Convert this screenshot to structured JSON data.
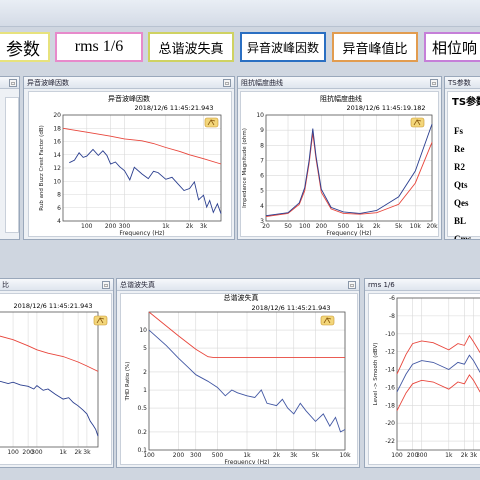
{
  "tabs": [
    {
      "label": "参数",
      "color": "#e7e27d"
    },
    {
      "label": "rms 1/6",
      "color": "#e78acb"
    },
    {
      "label": "总谐波失真",
      "color": "#cfd262"
    },
    {
      "label": "异音波峰因数",
      "color": "#2a6fc2"
    },
    {
      "label": "异音峰值比",
      "color": "#e29c4f"
    },
    {
      "label": "相位响",
      "color": "#c57fd8"
    }
  ],
  "panels": {
    "crest": {
      "header": "异音波峰因数",
      "title": "异音波峰因数",
      "timestamp": "2018/12/6 11:45:21.943"
    },
    "impedance": {
      "header": "阻抗幅度曲线",
      "title": "阻抗幅度曲线",
      "timestamp": "2018/12/6 11:45:19.182"
    },
    "ts": {
      "header": "TS参数",
      "title": "TS参数",
      "params": [
        "Fs",
        "Re",
        "R2",
        "Qts",
        "Qes",
        "BL",
        "Cms"
      ]
    },
    "ratio": {
      "header": "比",
      "timestamp": "2018/12/6 11:45:21.943"
    },
    "thd": {
      "header": "总谐波失真",
      "title": "总谐波失真",
      "timestamp": "2018/12/6 11:45:21.943"
    },
    "rms": {
      "header": "rms 1/6"
    }
  },
  "chart_data": [
    {
      "type": "line",
      "title": "异音波峰因数",
      "xlabel": "Frequency (Hz)",
      "ylabel": "Rub and Buzz Crest Factor (dB)",
      "xscale": "log",
      "xlim": [
        50,
        5000
      ],
      "ylim": [
        4,
        20
      ],
      "xticks": [
        100,
        200,
        300,
        1000,
        2000,
        3000
      ],
      "xticklabels": [
        "100",
        "200",
        "300",
        "1k",
        "2k",
        "3k"
      ],
      "yticks": [
        4,
        6,
        8,
        10,
        12,
        14,
        16,
        18,
        20
      ],
      "series": [
        {
          "color": "#e8463c",
          "x": [
            50,
            100,
            200,
            300,
            500,
            700,
            1000,
            1500,
            2000,
            3000,
            5000
          ],
          "y": [
            18,
            17.4,
            16.8,
            16.4,
            16.1,
            15.7,
            15.1,
            14.5,
            14,
            13.4,
            12.6
          ]
        },
        {
          "color": "#2b3f8f",
          "x": [
            60,
            70,
            80,
            90,
            100,
            120,
            140,
            160,
            180,
            200,
            230,
            260,
            300,
            350,
            400,
            500,
            600,
            700,
            800,
            1000,
            1200,
            1400,
            1700,
            2000,
            2300,
            2600,
            3000,
            3300,
            3600,
            4000,
            4500,
            5000
          ],
          "y": [
            12.8,
            13.2,
            14.3,
            13.6,
            13.8,
            14.8,
            13.9,
            14.6,
            13.9,
            12.6,
            12.9,
            12.2,
            11.6,
            10.2,
            12.1,
            11.1,
            10.4,
            11.5,
            11.3,
            10.3,
            10.6,
            9.7,
            8.6,
            8.9,
            9.9,
            7.2,
            7.9,
            6.1,
            7.1,
            5.3,
            6.6,
            5.1
          ]
        }
      ]
    },
    {
      "type": "line",
      "title": "阻抗幅度曲线",
      "xlabel": "Frequency (Hz)",
      "ylabel": "Impedance Magnitude (ohm)",
      "xscale": "log",
      "xlim": [
        20,
        20000
      ],
      "ylim": [
        3,
        10
      ],
      "xticks": [
        20,
        50,
        100,
        200,
        500,
        1000,
        2000,
        5000,
        10000,
        20000
      ],
      "xticklabels": [
        "20",
        "50",
        "100",
        "200",
        "500",
        "1k",
        "2k",
        "5k",
        "10k",
        "20k"
      ],
      "yticks": [
        3,
        4,
        5,
        6,
        7,
        8,
        9,
        10
      ],
      "series": [
        {
          "color": "#e8463c",
          "x": [
            20,
            50,
            80,
            100,
            120,
            140,
            160,
            200,
            300,
            500,
            1000,
            2000,
            5000,
            10000,
            20000
          ],
          "y": [
            3.3,
            3.5,
            4.1,
            5,
            6.8,
            8.8,
            7.1,
            4.9,
            3.8,
            3.5,
            3.45,
            3.55,
            4.1,
            5.5,
            8.2
          ]
        },
        {
          "color": "#2b3f8f",
          "x": [
            20,
            50,
            80,
            100,
            120,
            140,
            160,
            200,
            300,
            500,
            1000,
            2000,
            5000,
            10000,
            20000
          ],
          "y": [
            3.35,
            3.55,
            4.2,
            5.2,
            7,
            9.1,
            7.3,
            5.1,
            3.9,
            3.6,
            3.5,
            3.7,
            4.6,
            6.3,
            9.4
          ]
        }
      ]
    },
    {
      "type": "line",
      "xscale": "log",
      "xlim": [
        50,
        5000
      ],
      "ylim": [
        0,
        20
      ],
      "xticks": [
        100,
        200,
        300,
        1000,
        2000,
        3000
      ],
      "xticklabels": [
        "100",
        "200",
        "300",
        "1k",
        "2k",
        "3k"
      ],
      "series": [
        {
          "color": "#e8463c",
          "x": [
            50,
            100,
            200,
            300,
            500,
            1000,
            2000,
            3000,
            5000
          ],
          "y": [
            16.5,
            15.9,
            15,
            14.4,
            13.9,
            13.4,
            12.6,
            12,
            11.2
          ]
        },
        {
          "color": "#2b3f8f",
          "x": [
            50,
            80,
            100,
            140,
            200,
            260,
            300,
            400,
            500,
            700,
            1000,
            1300,
            1600,
            2000,
            2500,
            3000,
            3500,
            4000,
            4500,
            5000
          ],
          "y": [
            9.8,
            9.4,
            9.6,
            9.2,
            9,
            8.6,
            9.1,
            8.4,
            8.6,
            7.8,
            7.1,
            7.3,
            6.6,
            6.1,
            5.5,
            4.9,
            3.8,
            3.2,
            2.6,
            1.6
          ]
        }
      ]
    },
    {
      "type": "line",
      "title": "总谐波失真",
      "xlabel": "Frequency (Hz)",
      "ylabel": "THD Ratio (%)",
      "xscale": "log",
      "yscale": "log",
      "xlim": [
        100,
        10000
      ],
      "ylim": [
        0.1,
        20
      ],
      "xticks": [
        100,
        200,
        300,
        500,
        1000,
        2000,
        3000,
        5000,
        10000
      ],
      "xticklabels": [
        "100",
        "200",
        "300",
        "500",
        "1k",
        "2k",
        "3k",
        "5k",
        "10k"
      ],
      "yticks": [
        0.1,
        0.2,
        0.5,
        1,
        2,
        5,
        10
      ],
      "yticklabels": [
        "0.1",
        "0.2",
        "0.5",
        "1",
        "2",
        "5",
        "10"
      ],
      "series": [
        {
          "color": "#e8463c",
          "x": [
            100,
            200,
            300,
            400,
            450,
            1000,
            2000,
            5000,
            10000
          ],
          "y": [
            20,
            8,
            4.8,
            3.6,
            3.5,
            3.5,
            3.5,
            3.5,
            3.5
          ]
        },
        {
          "color": "#4257a3",
          "x": [
            100,
            150,
            200,
            250,
            300,
            400,
            500,
            600,
            700,
            800,
            1000,
            1200,
            1400,
            1600,
            2000,
            2300,
            2600,
            3000,
            3500,
            4000,
            5000,
            6000,
            7000,
            8000,
            9000,
            10000
          ],
          "y": [
            10,
            5.5,
            3.4,
            2.4,
            1.8,
            1.4,
            1.1,
            0.8,
            1,
            0.9,
            0.8,
            0.75,
            1,
            0.6,
            0.55,
            0.7,
            0.5,
            0.4,
            0.6,
            0.45,
            0.3,
            0.4,
            0.25,
            0.35,
            0.2,
            0.22
          ]
        }
      ]
    },
    {
      "type": "line",
      "ylabel": "Level -> Smooth (dBV)",
      "xscale": "log",
      "xlim": [
        100,
        5000
      ],
      "ylim": [
        -23,
        -6
      ],
      "xticks": [
        100,
        200,
        300,
        1000,
        2000,
        3000
      ],
      "xticklabels": [
        "100",
        "200",
        "300",
        "1k",
        "2k",
        "3k"
      ],
      "yticks": [
        -22,
        -20,
        -18,
        -16,
        -14,
        -12,
        -10,
        -8,
        -6
      ],
      "series": [
        {
          "color": "#e8463c",
          "x": [
            100,
            150,
            200,
            300,
            500,
            1000,
            1500,
            2000,
            2500,
            3000,
            4000,
            5000
          ],
          "y": [
            -14.5,
            -12.3,
            -11.1,
            -10.8,
            -11,
            -11.8,
            -11.1,
            -11.3,
            -10.2,
            -10.9,
            -12.1,
            -12.6
          ]
        },
        {
          "color": "#4257a3",
          "x": [
            100,
            150,
            200,
            300,
            500,
            1000,
            1500,
            2000,
            2500,
            3000,
            4000,
            5000
          ],
          "y": [
            -16.5,
            -14.5,
            -13.4,
            -13,
            -13.2,
            -14,
            -13.2,
            -13.4,
            -12.4,
            -13,
            -14.3,
            -14.8
          ]
        },
        {
          "color": "#e8463c",
          "x": [
            100,
            150,
            200,
            300,
            500,
            1000,
            1500,
            2000,
            2500,
            3000,
            4000,
            5000
          ],
          "y": [
            -18.6,
            -16.6,
            -15.6,
            -15.2,
            -15.4,
            -16.2,
            -15.4,
            -15.6,
            -14.6,
            -15.2,
            -16.5,
            -17
          ]
        }
      ]
    }
  ]
}
